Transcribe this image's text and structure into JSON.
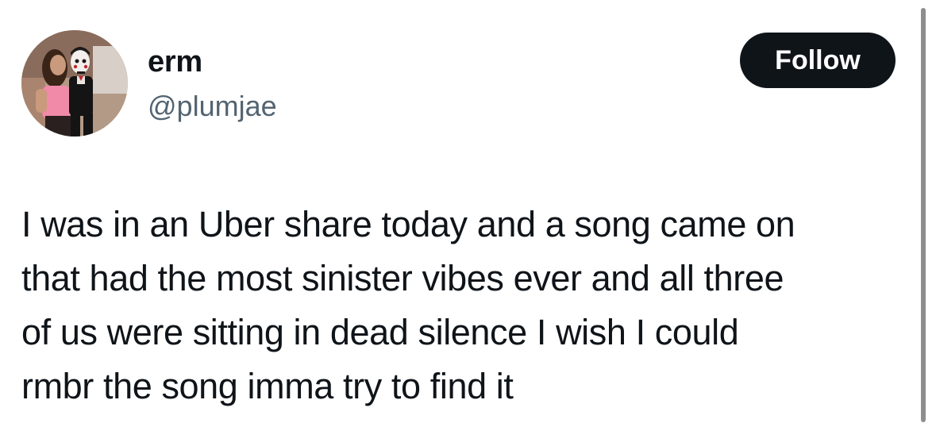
{
  "author": {
    "display_name": "erm",
    "handle": "@plumjae",
    "avatar_icon": "profile-photo"
  },
  "actions": {
    "follow_label": "Follow"
  },
  "tweet": {
    "text": "I was in an Uber share today and a song came on\nthat had the most sinister vibes ever and all three\nof us were sitting in dead silence I wish I could\nrmbr the song imma try to find it"
  },
  "colors": {
    "text_primary": "#0f1419",
    "text_secondary": "#536471",
    "button_bg": "#0f1419",
    "button_text": "#ffffff",
    "background": "#ffffff"
  }
}
